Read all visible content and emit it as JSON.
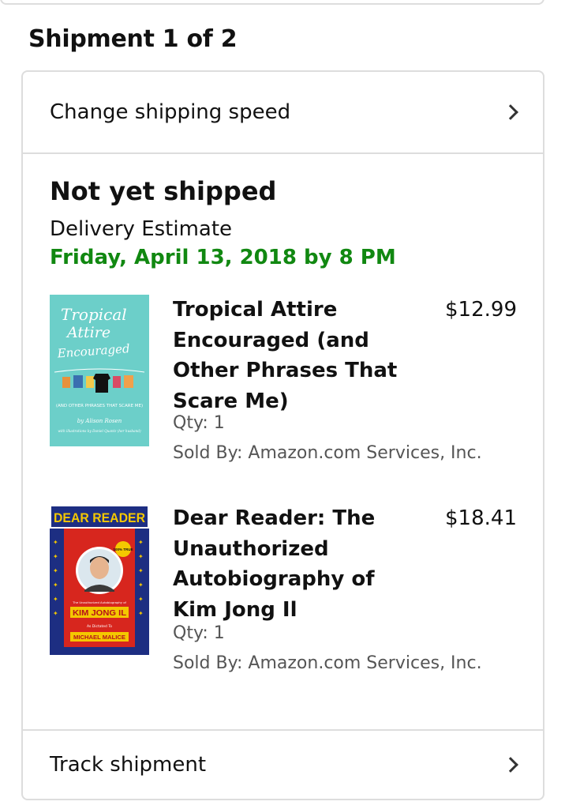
{
  "shipment_heading": "Shipment 1 of 2",
  "change_speed_label": "Change shipping speed",
  "status": {
    "title": "Not yet shipped",
    "estimate_label": "Delivery Estimate",
    "estimate_date": "Friday, April 13, 2018 by 8 PM"
  },
  "items": [
    {
      "title": "Tropical Attire Encouraged (and Other Phrases That Scare Me)",
      "price": "$12.99",
      "qty": "Qty: 1",
      "seller": "Sold By: Amazon.com Services, Inc.",
      "cover": {
        "title_line1": "Tropical",
        "title_line2": "Attire",
        "title_line3": "Encouraged",
        "subtitle": "(AND OTHER PHRASES THAT SCARE ME)",
        "author": "by Alison Rosen",
        "illustrator": "with illustrations by Daniel Quantz (her husband)",
        "bg_color": "#6ccfc9"
      }
    },
    {
      "title": "Dear Reader: The Unauthorized Autobiography of Kim Jong Il",
      "price": "$18.41",
      "qty": "Qty: 1",
      "seller": "Sold By: Amazon.com Services, Inc.",
      "cover": {
        "banner": "DEAR READER",
        "badge": "100% TRUE",
        "subtitle": "The Unauthorized Autobiography of",
        "name": "KIM JONG IL",
        "as_dictated": "As Dictated To",
        "author": "MICHAEL MALICE",
        "red": "#d7261e",
        "blue": "#1d2e82",
        "yellow": "#f4c800"
      }
    }
  ],
  "track_label": "Track shipment",
  "colors": {
    "estimate_green": "#118811",
    "border": "#dddddd",
    "muted_text": "#555555"
  }
}
